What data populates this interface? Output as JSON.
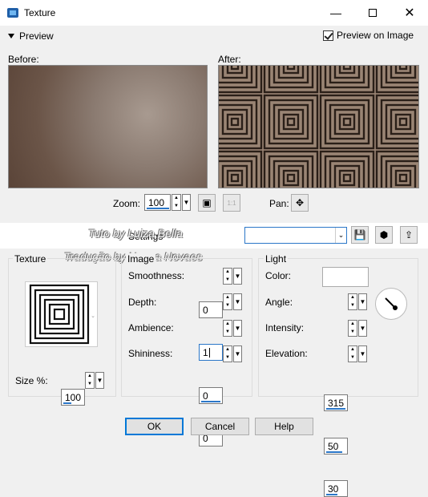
{
  "window": {
    "title": "Texture"
  },
  "preview": {
    "toggle_label": "Preview",
    "preview_on_image_label": "Preview on Image",
    "preview_on_image_checked": true
  },
  "before": {
    "label": "Before:"
  },
  "after": {
    "label": "After:"
  },
  "zoom": {
    "label": "Zoom:",
    "value": "100",
    "pan_label": "Pan:"
  },
  "settings": {
    "label": "Settings",
    "preset_value": ""
  },
  "watermark": {
    "line1": "Tuto by Luiza Bella",
    "line2": "Tradução by Neusa Novaes"
  },
  "texture": {
    "group_label": "Texture",
    "size_label": "Size %:",
    "size_value": "100"
  },
  "image": {
    "group_label": "Image",
    "smoothness_label": "Smoothness:",
    "smoothness_value": "0",
    "depth_label": "Depth:",
    "depth_value": "1",
    "ambience_label": "Ambience:",
    "ambience_value": "0",
    "shininess_label": "Shininess:",
    "shininess_value": "0"
  },
  "light": {
    "group_label": "Light",
    "color_label": "Color:",
    "color_value": "#ffffff",
    "angle_label": "Angle:",
    "angle_value": "315",
    "intensity_label": "Intensity:",
    "intensity_value": "50",
    "elevation_label": "Elevation:",
    "elevation_value": "30"
  },
  "buttons": {
    "ok": "OK",
    "cancel": "Cancel",
    "help": "Help"
  }
}
